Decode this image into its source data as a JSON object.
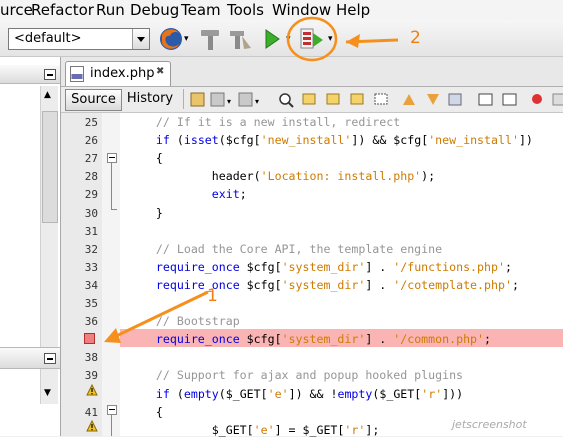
{
  "menu": [
    "urce",
    "Refactor",
    "Run",
    "Debug",
    "Team",
    "Tools",
    "Window",
    "Help"
  ],
  "toolbar": {
    "config": "<default>",
    "annotation_2": "2"
  },
  "tab": {
    "title": "index.php"
  },
  "editor_toolbar": {
    "source": "Source",
    "history": "History"
  },
  "annotation_1": "1",
  "watermark": "jetscreenshot",
  "lines": [
    {
      "n": "25",
      "code": [
        {
          "t": "    // If it is a new install, redirect",
          "c": "com"
        }
      ]
    },
    {
      "n": "26",
      "code": [
        {
          "t": "    ",
          "c": "var"
        },
        {
          "t": "if",
          "c": "kw"
        },
        {
          "t": " (",
          "c": "var"
        },
        {
          "t": "isset",
          "c": "kw"
        },
        {
          "t": "($cfg[",
          "c": "var"
        },
        {
          "t": "'new_install'",
          "c": "str"
        },
        {
          "t": "]) && $cfg[",
          "c": "var"
        },
        {
          "t": "'new_install'",
          "c": "str"
        },
        {
          "t": "])",
          "c": "var"
        }
      ]
    },
    {
      "n": "27",
      "code": [
        {
          "t": "    {",
          "c": "var"
        }
      ]
    },
    {
      "n": "28",
      "code": [
        {
          "t": "            header(",
          "c": "var"
        },
        {
          "t": "'Location: install.php'",
          "c": "str"
        },
        {
          "t": ");",
          "c": "var"
        }
      ]
    },
    {
      "n": "29",
      "code": [
        {
          "t": "            ",
          "c": "var"
        },
        {
          "t": "exit",
          "c": "kw"
        },
        {
          "t": ";",
          "c": "var"
        }
      ]
    },
    {
      "n": "30",
      "code": [
        {
          "t": "    }",
          "c": "var"
        }
      ]
    },
    {
      "n": "31",
      "code": []
    },
    {
      "n": "32",
      "code": [
        {
          "t": "    // Load the Core API, the template engine",
          "c": "com"
        }
      ]
    },
    {
      "n": "33",
      "code": [
        {
          "t": "    ",
          "c": "var"
        },
        {
          "t": "require_once",
          "c": "kw"
        },
        {
          "t": " $cfg[",
          "c": "var"
        },
        {
          "t": "'system_dir'",
          "c": "str"
        },
        {
          "t": "] . ",
          "c": "var"
        },
        {
          "t": "'/functions.php'",
          "c": "str"
        },
        {
          "t": ";",
          "c": "var"
        }
      ]
    },
    {
      "n": "34",
      "code": [
        {
          "t": "    ",
          "c": "var"
        },
        {
          "t": "require_once",
          "c": "kw"
        },
        {
          "t": " $cfg[",
          "c": "var"
        },
        {
          "t": "'system_dir'",
          "c": "str"
        },
        {
          "t": "] . ",
          "c": "var"
        },
        {
          "t": "'/cotemplate.php'",
          "c": "str"
        },
        {
          "t": ";",
          "c": "var"
        }
      ]
    },
    {
      "n": "35",
      "code": []
    },
    {
      "n": "36",
      "code": [
        {
          "t": "    // Bootstrap",
          "c": "com"
        }
      ]
    },
    {
      "n": "",
      "code": [
        {
          "t": "    ",
          "c": "var"
        },
        {
          "t": "require_once",
          "c": "kw"
        },
        {
          "t": " $cfg[",
          "c": "var"
        },
        {
          "t": "'system_dir'",
          "c": "str"
        },
        {
          "t": "] . ",
          "c": "var"
        },
        {
          "t": "'/common.php'",
          "c": "str"
        },
        {
          "t": ";",
          "c": "var"
        }
      ]
    },
    {
      "n": "38",
      "code": []
    },
    {
      "n": "39",
      "code": [
        {
          "t": "    // Support for ajax and popup hooked plugins",
          "c": "com"
        }
      ]
    },
    {
      "n": "",
      "code": [
        {
          "t": "    ",
          "c": "var"
        },
        {
          "t": "if",
          "c": "kw"
        },
        {
          "t": " (",
          "c": "var"
        },
        {
          "t": "empty",
          "c": "kw"
        },
        {
          "t": "($_GET[",
          "c": "var"
        },
        {
          "t": "'e'",
          "c": "str"
        },
        {
          "t": "]) && !",
          "c": "var"
        },
        {
          "t": "empty",
          "c": "kw"
        },
        {
          "t": "($_GET[",
          "c": "var"
        },
        {
          "t": "'r'",
          "c": "str"
        },
        {
          "t": "]))",
          "c": "var"
        }
      ]
    },
    {
      "n": "41",
      "code": [
        {
          "t": "    {",
          "c": "var"
        }
      ]
    },
    {
      "n": "",
      "code": [
        {
          "t": "            $_GET[",
          "c": "var"
        },
        {
          "t": "'e'",
          "c": "str"
        },
        {
          "t": "] = $_GET[",
          "c": "var"
        },
        {
          "t": "'r'",
          "c": "str"
        },
        {
          "t": "];",
          "c": "var"
        }
      ]
    }
  ]
}
